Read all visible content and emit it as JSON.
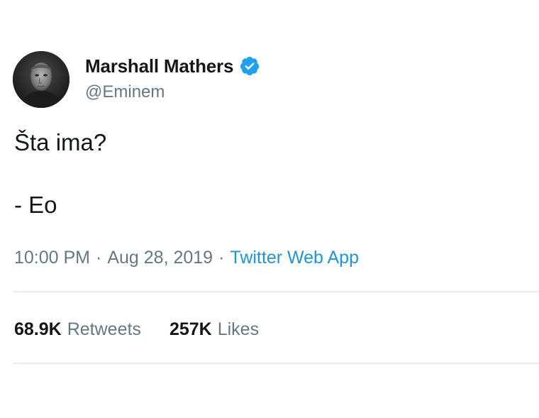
{
  "tweet": {
    "display_name": "Marshall Mathers",
    "handle": "@Eminem",
    "verified": true,
    "text_lines": [
      "Šta ima?",
      "- Eo"
    ],
    "time": "10:00 PM",
    "date": "Aug 28, 2019",
    "separator": "·",
    "source": "Twitter Web App",
    "retweets_count": "68.9K",
    "retweets_label": "Retweets",
    "likes_count": "257K",
    "likes_label": "Likes"
  },
  "colors": {
    "accent": "#1b95e0",
    "verified_badge": "#1da1f2",
    "secondary_text": "#657786",
    "primary_text": "#14171a",
    "divider": "#e6ecf0"
  },
  "icons": {
    "avatar": "profile-photo",
    "verified": "verified-badge-icon"
  }
}
